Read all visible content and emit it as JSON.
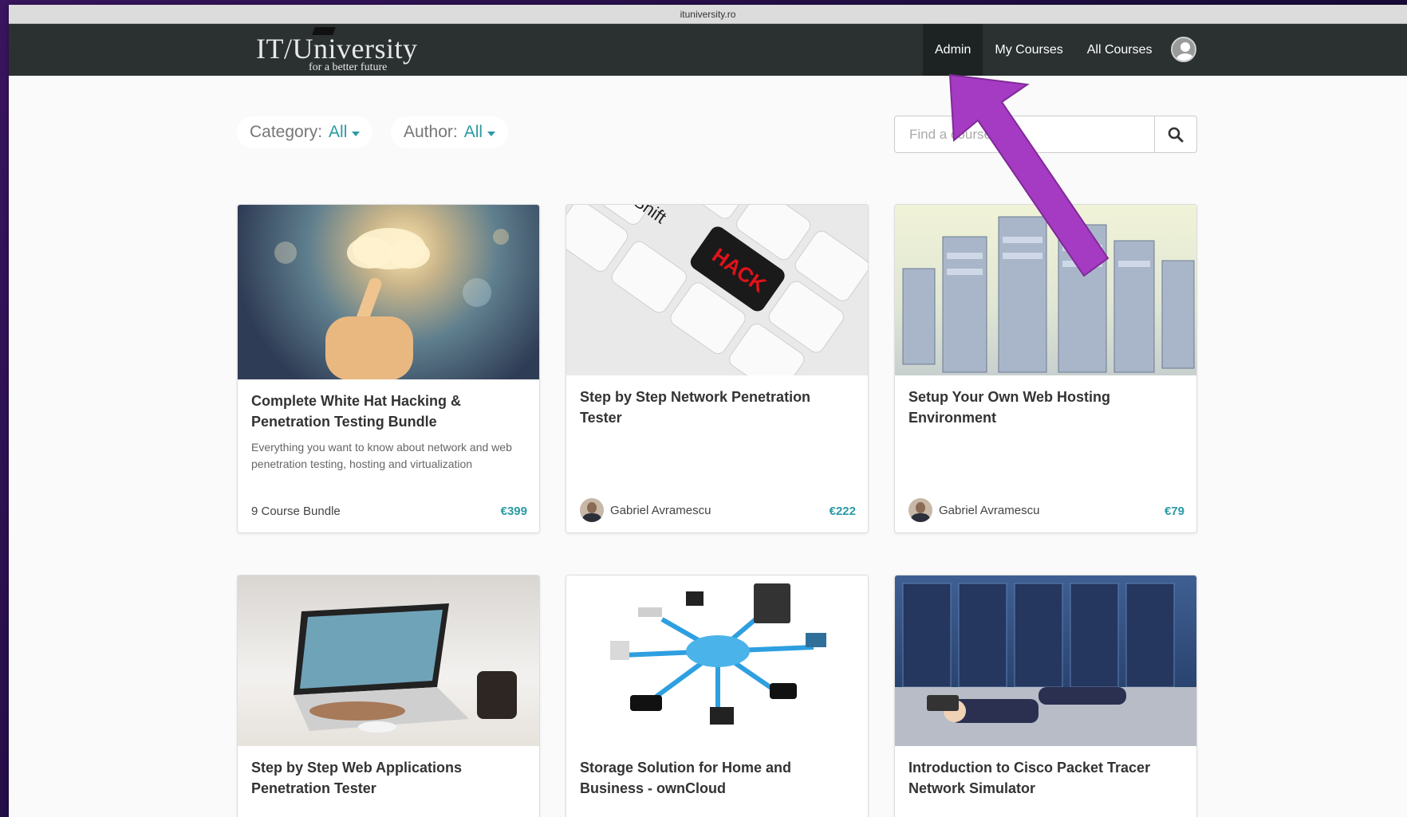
{
  "browser": {
    "url": "ituniversity.ro"
  },
  "logo": {
    "main": "IT/University",
    "tagline": "for a better future"
  },
  "nav": {
    "items": [
      {
        "label": "Admin",
        "active": true
      },
      {
        "label": "My Courses",
        "active": false
      },
      {
        "label": "All Courses",
        "active": false
      }
    ]
  },
  "filters": {
    "category": {
      "label": "Category:",
      "value": "All"
    },
    "author": {
      "label": "Author:",
      "value": "All"
    }
  },
  "search": {
    "placeholder": "Find a course"
  },
  "courses": [
    {
      "title": "Complete White Hat Hacking & Penetration Testing Bundle",
      "description": "Everything you want to know about network and web penetration testing, hosting and virtualization",
      "footer": "9 Course Bundle",
      "price": "€399",
      "image": "cloud-touch-image"
    },
    {
      "title": "Step by Step Network Penetration Tester",
      "description": "",
      "footer": "Gabriel Avramescu",
      "price": "€222",
      "image": "hack-keyboard-image"
    },
    {
      "title": "Setup Your Own Web Hosting Environment",
      "description": "",
      "footer": "Gabriel Avramescu",
      "price": "€79",
      "image": "servers-image"
    },
    {
      "title": "Step by Step Web Applications Penetration Tester",
      "image": "laptop-desk-image"
    },
    {
      "title": "Storage Solution for Home and Business - ownCloud",
      "image": "cloud-network-image"
    },
    {
      "title": "Introduction to Cisco Packet Tracer Network Simulator",
      "image": "datacenter-sleeping-image"
    }
  ],
  "colors": {
    "accent": "#2a9aa5",
    "navbar": "#2a3130",
    "arrow": "#a53bc2"
  }
}
